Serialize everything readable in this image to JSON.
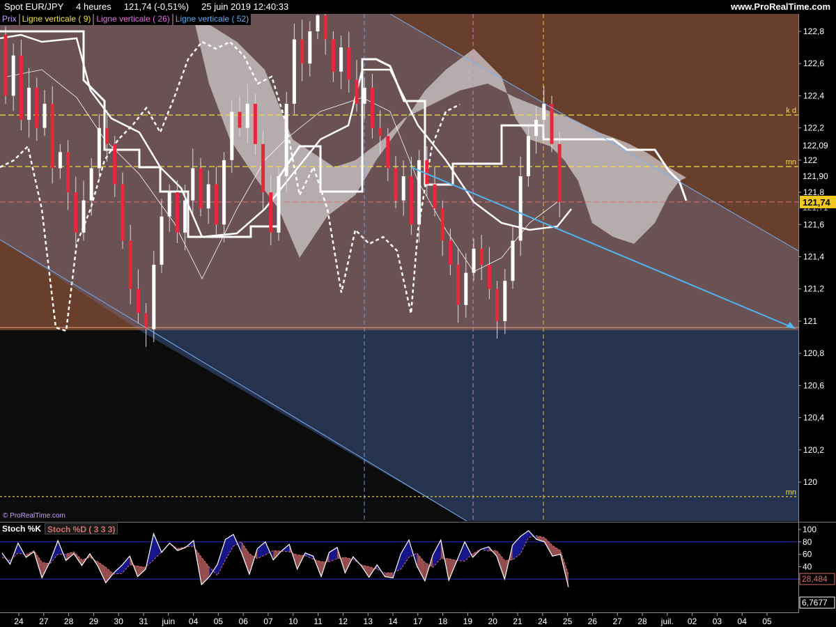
{
  "header": {
    "instrument": "Spot EUR/JPY",
    "timeframe": "4 heures",
    "last_value": "121,74 (-0,51%)",
    "datetime": "25 juin 2019 12:40:33",
    "site": "www.ProRealTime.com"
  },
  "legend": {
    "price": "Prix",
    "line9": "Ligne verticale ( 9)",
    "line26": "Ligne verticale ( 26)",
    "line52": "Ligne verticale ( 52)"
  },
  "watermark": "© ProRealTime.com",
  "colors": {
    "zone_upper_brown": "#683f2c",
    "zone_channel": "#6a5154",
    "zone_lower_navy": "#26334f",
    "bull_candle": "#ffffff",
    "bear_candle": "#e8283a",
    "kumo_cloud": "#d4d0d0",
    "trendline_blue": "#4fb4f0",
    "level_yellow": "#f0e040",
    "price_tag": "#f0c81e",
    "stoch_k": "#ffffff",
    "stoch_d": "#d07070"
  },
  "price_axis": {
    "ticks": [
      "122,8",
      "122,6",
      "122,4",
      "122,2",
      "122",
      "121,8",
      "121,6",
      "121,4",
      "121,2",
      "121",
      "120,8",
      "120,6",
      "120,4",
      "120,2",
      "120"
    ],
    "tag_122_09": "122,09",
    "tag_121_90": "121,90",
    "tag_121_75": "121,75",
    "tag_121_71": "121,71",
    "current_price": "121,74"
  },
  "levels": {
    "kd": "k d",
    "mn_upper": "mn",
    "mn_lower": "mn"
  },
  "time_axis": {
    "labels": [
      "24",
      "27",
      "28",
      "29",
      "30",
      "31",
      "juin",
      "04",
      "05",
      "06",
      "07",
      "10",
      "11",
      "12",
      "13",
      "14",
      "17",
      "18",
      "19",
      "20",
      "21",
      "24",
      "25",
      "26",
      "27",
      "28",
      "juil.",
      "02",
      "03",
      "04",
      "05"
    ]
  },
  "stoch": {
    "k_label": "Stoch %K",
    "d_label": "Stoch %D ( 3 3 3)",
    "ticks": [
      "100",
      "80",
      "60",
      "40",
      "20"
    ],
    "d_value": "28,484",
    "k_value": "6,7677"
  },
  "chart_data": [
    {
      "type": "candlestick",
      "title": "Spot EUR/JPY",
      "timeframe": "4 heures",
      "ylim": [
        119.85,
        122.95
      ],
      "horizontal_levels": [
        {
          "label": "k d",
          "value": 122.28
        },
        {
          "label": "mn",
          "value": 121.96
        },
        {
          "label": "mn",
          "value": 119.91
        },
        {
          "label": "",
          "value": 120.96
        },
        {
          "label": "",
          "value": 121.74
        }
      ],
      "price_path": [
        122.78,
        122.4,
        122.65,
        122.25,
        122.45,
        122.2,
        122.35,
        121.95,
        122.05,
        121.8,
        121.55,
        121.75,
        121.95,
        122.2,
        122.1,
        121.85,
        121.5,
        121.2,
        121.05,
        120.95,
        121.35,
        121.65,
        121.8,
        121.55,
        121.75,
        121.95,
        121.7,
        121.85,
        121.6,
        122.0,
        122.3,
        122.2,
        122.35,
        122.1,
        121.8,
        121.55,
        121.9,
        122.35,
        122.75,
        122.6,
        122.8,
        122.9,
        122.75,
        122.55,
        122.7,
        122.5,
        122.35,
        122.45,
        122.2,
        122.15,
        121.95,
        121.75,
        121.9,
        121.6,
        122.0,
        121.85,
        121.7,
        121.5,
        121.35,
        121.1,
        121.3,
        121.45,
        121.35,
        121.2,
        121.0,
        121.25,
        121.5,
        121.9,
        122.15,
        122.25,
        122.35,
        122.1,
        121.74
      ]
    },
    {
      "type": "line",
      "title": "Stoch %K / Stoch %D ( 3 3 3)",
      "ylim": [
        0,
        100
      ],
      "series": [
        {
          "name": "Stoch %K",
          "values": [
            62,
            44,
            78,
            55,
            64,
            22,
            48,
            82,
            50,
            61,
            42,
            61,
            41,
            14,
            30,
            42,
            57,
            24,
            36,
            93,
            63,
            78,
            66,
            71,
            82,
            11,
            24,
            44,
            84,
            92,
            63,
            28,
            69,
            80,
            51,
            65,
            76,
            36,
            62,
            57,
            24,
            63,
            71,
            30,
            56,
            42,
            23,
            43,
            24,
            22,
            61,
            83,
            41,
            17,
            59,
            83,
            18,
            49,
            80,
            55,
            68,
            72,
            57,
            20,
            75,
            89,
            98,
            84,
            80,
            57,
            60,
            7
          ]
        },
        {
          "name": "Stoch %D ( 3 3 3)",
          "values": [
            55,
            50,
            62,
            59,
            66,
            47,
            45,
            60,
            60,
            64,
            51,
            55,
            48,
            39,
            28,
            29,
            43,
            41,
            39,
            51,
            64,
            78,
            69,
            72,
            73,
            55,
            39,
            26,
            51,
            73,
            80,
            61,
            53,
            59,
            66,
            65,
            64,
            59,
            58,
            52,
            48,
            48,
            53,
            55,
            52,
            43,
            40,
            36,
            30,
            30,
            36,
            55,
            62,
            47,
            39,
            53,
            53,
            50,
            49,
            61,
            68,
            65,
            66,
            50,
            51,
            61,
            87,
            90,
            87,
            74,
            66,
            28
          ]
        }
      ]
    }
  ]
}
